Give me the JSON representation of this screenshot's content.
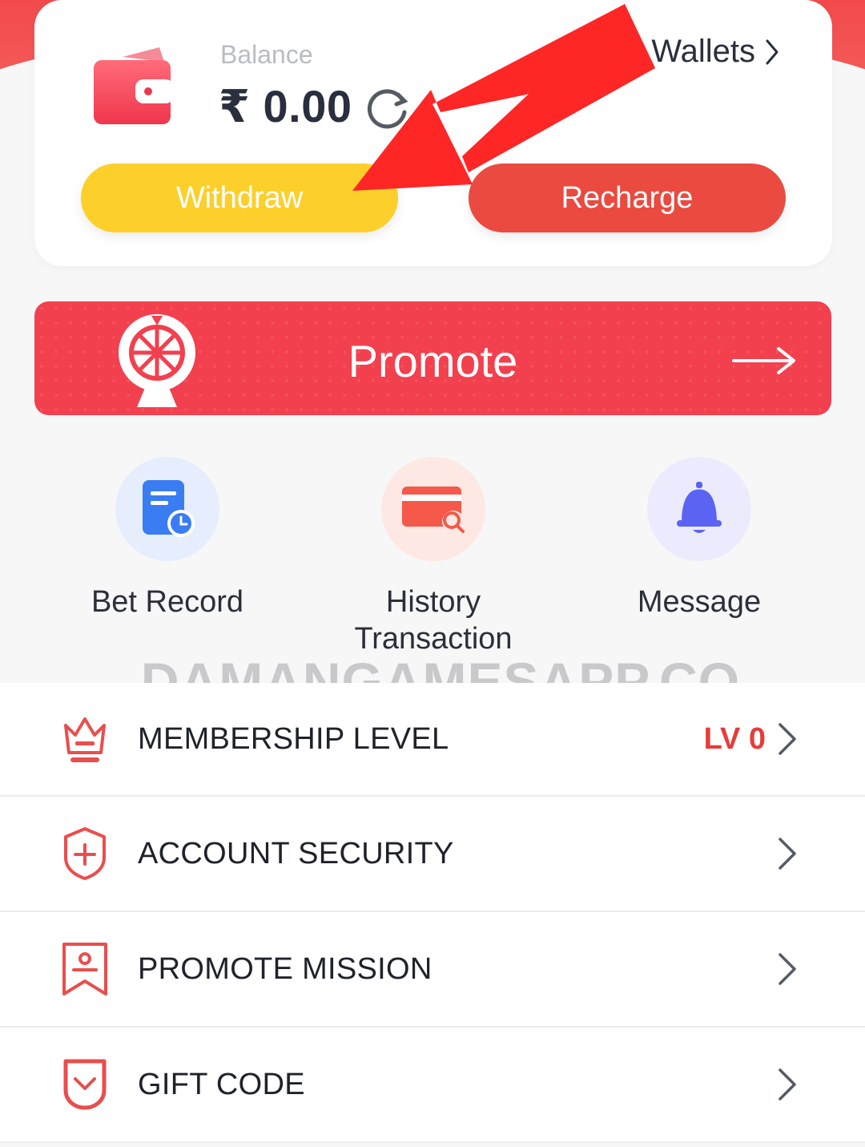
{
  "colors": {
    "accent_red": "#EA4A40",
    "withdraw_yellow": "#FDCF2B",
    "promote_red": "#F2404F",
    "level_red": "#E53D3A"
  },
  "wallet": {
    "balance_label": "Balance",
    "balance_amount": "₹ 0.00",
    "wallets_link": "Wallets",
    "withdraw_label": "Withdraw",
    "recharge_label": "Recharge",
    "icons": [
      "wallet-icon",
      "refresh-icon",
      "chevron-right-icon"
    ]
  },
  "promote": {
    "label": "Promote",
    "icons": [
      "prize-wheel-icon",
      "arrow-right-icon"
    ]
  },
  "quick_actions": [
    {
      "label": "Bet Record",
      "icon": "bet-record-icon"
    },
    {
      "label": "History Transaction",
      "icon": "transaction-history-icon"
    },
    {
      "label": "Message",
      "icon": "bell-icon"
    }
  ],
  "watermark": "DAMANGAMESAPP.CO",
  "menu": [
    {
      "label": "MEMBERSHIP LEVEL",
      "value": "LV 0",
      "icon": "crown-icon"
    },
    {
      "label": "ACCOUNT SECURITY",
      "icon": "shield-icon"
    },
    {
      "label": "PROMOTE MISSION",
      "icon": "mission-badge-icon"
    },
    {
      "label": "GIFT CODE",
      "icon": "gift-code-icon"
    }
  ]
}
